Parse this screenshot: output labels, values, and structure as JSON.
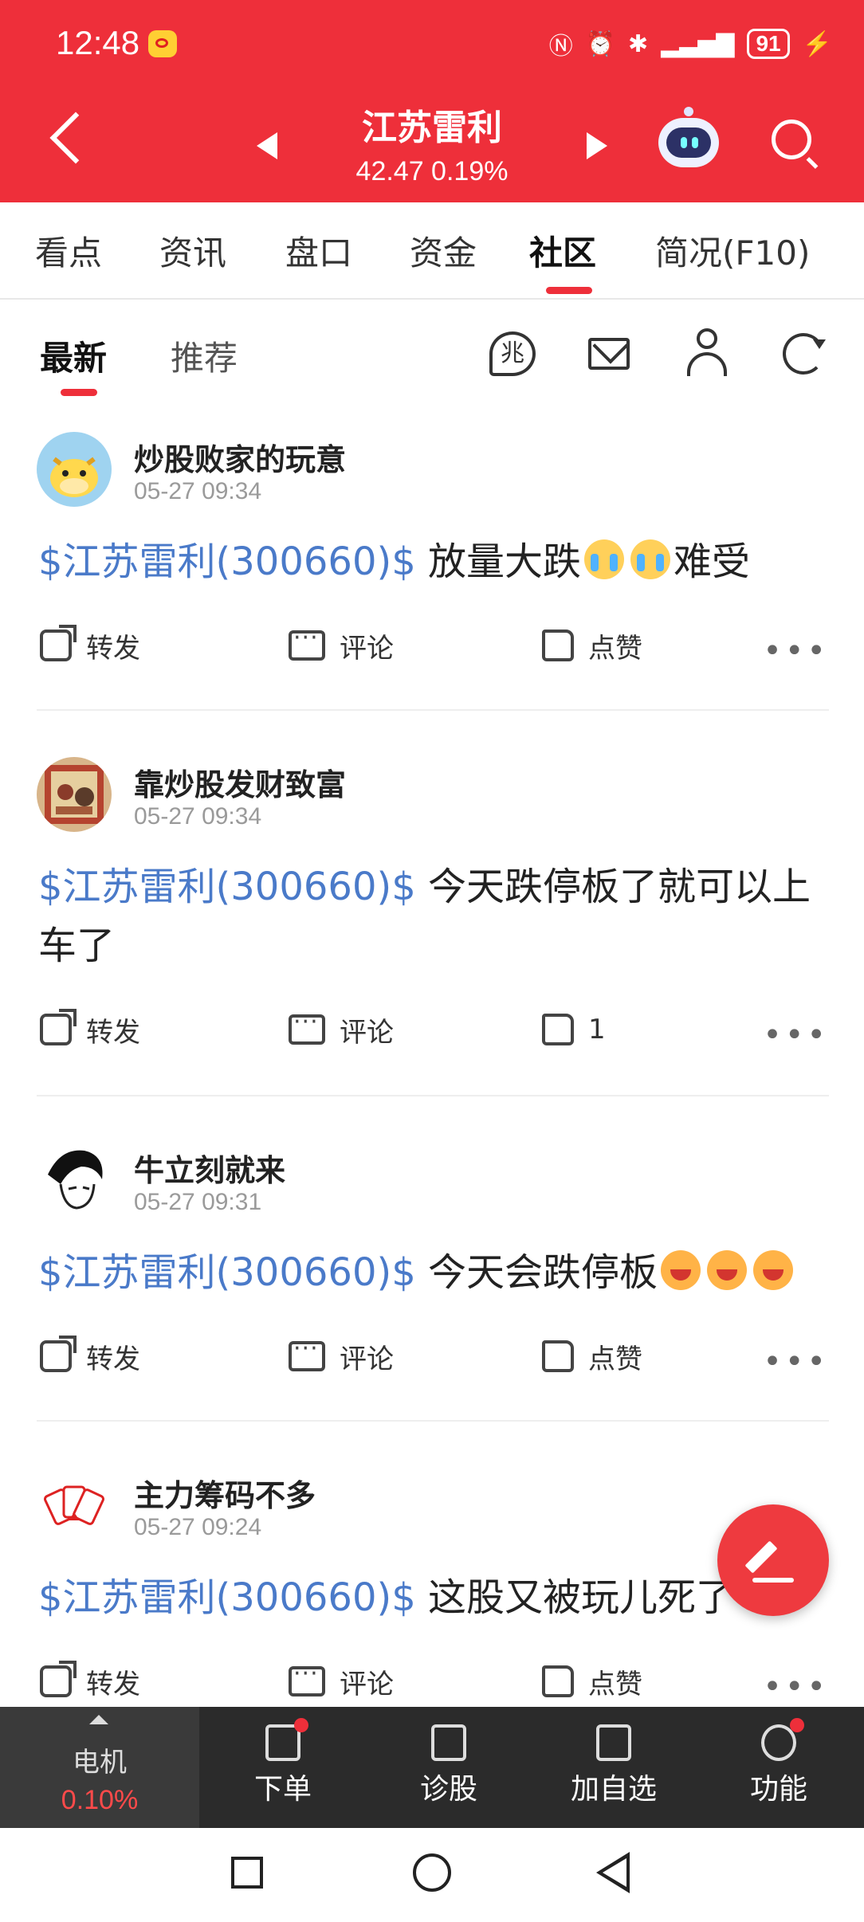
{
  "status_bar": {
    "time": "12:48",
    "battery": "91"
  },
  "header": {
    "stock_name": "江苏雷利",
    "price_line": "42.47 0.19%"
  },
  "tabs": [
    "看点",
    "资讯",
    "盘口",
    "资金",
    "社区",
    "简况(F10)"
  ],
  "active_tab": "社区",
  "sub_tabs": [
    "最新",
    "推荐"
  ],
  "leaf_icon_glyph": "兆",
  "posts": [
    {
      "user": "炒股败家的玩意",
      "time": "05-27 09:34",
      "tag": "$江苏雷利(300660)$",
      "text_before": " 放量大跌",
      "text_after": "难受",
      "emoji": "cry",
      "emoji_count": 2,
      "share": "转发",
      "comment": "评论",
      "like": "点赞"
    },
    {
      "user": "靠炒股发财致富",
      "time": "05-27 09:34",
      "tag": "$江苏雷利(300660)$",
      "text_before": " 今天跌停板了就可以上车了",
      "text_after": "",
      "emoji": "none",
      "emoji_count": 0,
      "share": "转发",
      "comment": "评论",
      "like": "1"
    },
    {
      "user": "牛立刻就来",
      "time": "05-27 09:31",
      "tag": "$江苏雷利(300660)$",
      "text_before": " 今天会跌停板",
      "text_after": "",
      "emoji": "laugh",
      "emoji_count": 3,
      "share": "转发",
      "comment": "评论",
      "like": "点赞"
    },
    {
      "user": "主力筹码不多",
      "time": "05-27 09:24",
      "tag": "$江苏雷利(300660)$",
      "text_before": " 这股又被玩儿死了",
      "text_after": "",
      "emoji": "none",
      "emoji_count": 0,
      "share": "转发",
      "comment": "评论",
      "like": "点赞"
    }
  ],
  "bottom_bar": {
    "sector_name": "电机",
    "sector_change": "0.10%",
    "items": [
      "下单",
      "诊股",
      "加自选",
      "功能"
    ]
  },
  "colors": {
    "brand_red": "#ee2f3a",
    "tag_blue": "#4a7ac9"
  }
}
